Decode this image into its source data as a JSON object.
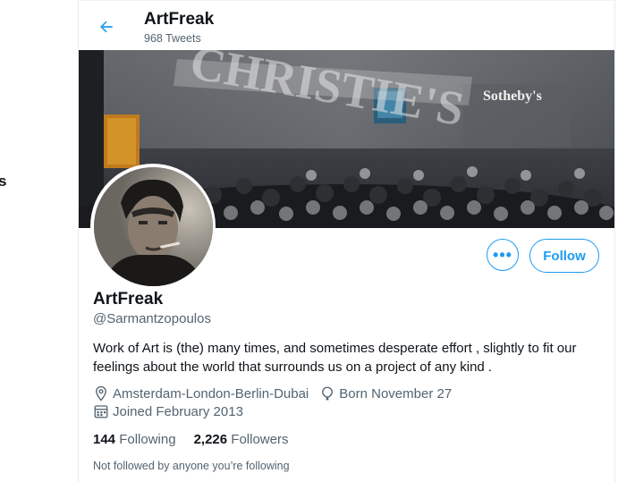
{
  "header": {
    "title": "ArtFreak",
    "tweet_count": "968 Tweets"
  },
  "left": {
    "partial_letter": "s"
  },
  "banner": {
    "logo_christies": "CHRISTIE'S",
    "logo_sothebys": "Sotheby's"
  },
  "profile": {
    "name": "ArtFreak",
    "handle": "@Sarmantzopoulos",
    "bio": "Work of Art is (the) many times, and sometimes desperate effort , slightly to fit our feelings about the world that surrounds us on a project of any kind .",
    "location": "Amsterdam-London-Berlin-Dubai",
    "birthday": "Born November 27",
    "joined": "Joined February 2013",
    "following_count": "144",
    "following_label": "Following",
    "followers_count": "2,226",
    "followers_label": "Followers",
    "not_followed_note": "Not followed by anyone you’re following"
  },
  "actions": {
    "more_label": "•••",
    "follow_label": "Follow"
  },
  "colors": {
    "accent": "#1d9bf0",
    "secondary_text": "#536471",
    "primary_text": "#0f1419"
  },
  "icons": {
    "back": "arrow-left-icon",
    "location": "location-pin-icon",
    "birthday": "balloon-icon",
    "joined": "calendar-icon"
  }
}
